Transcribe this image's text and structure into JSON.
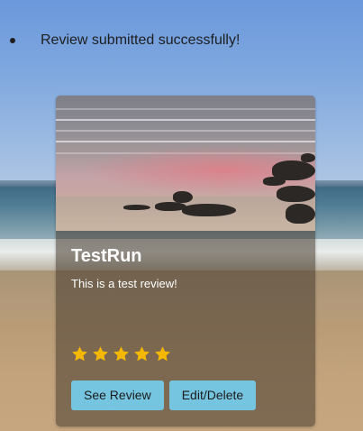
{
  "alerts": [
    {
      "text": "Review submitted successfully!"
    }
  ],
  "card": {
    "title": "TestRun",
    "body": "This is a test review!",
    "rating": 5,
    "rating_max": 5,
    "star_color": "#f5b800",
    "buttons": {
      "see_review": "See Review",
      "edit_delete": "Edit/Delete"
    },
    "button_color": "#76c5e0"
  }
}
